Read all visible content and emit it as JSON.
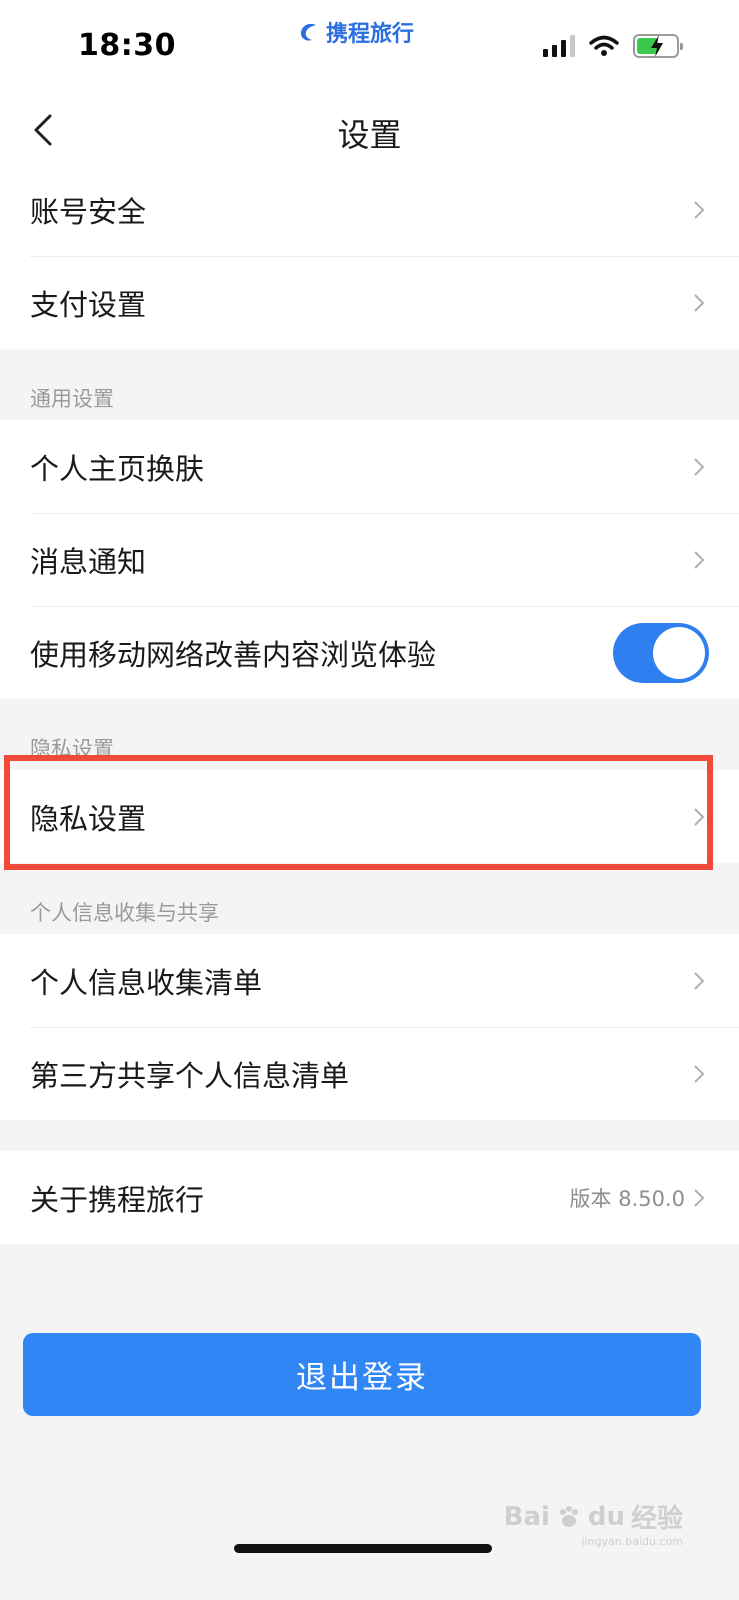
{
  "status_bar": {
    "time": "18:30",
    "brand": "携程旅行",
    "battery_color": "#3cc84a"
  },
  "nav": {
    "title": "设置"
  },
  "groups": {
    "account": [
      {
        "label": "账号安全"
      },
      {
        "label": "支付设置"
      }
    ],
    "general": {
      "header": "通用设置",
      "items": [
        {
          "label": "个人主页换肤"
        },
        {
          "label": "消息通知"
        },
        {
          "label": "使用移动网络改善内容浏览体验",
          "toggle_on": true
        }
      ]
    },
    "privacy": {
      "header": "隐私设置",
      "items": [
        {
          "label": "隐私设置"
        }
      ]
    },
    "personal_info": {
      "header": "个人信息收集与共享",
      "items": [
        {
          "label": "个人信息收集清单"
        },
        {
          "label": "第三方共享个人信息清单"
        }
      ]
    },
    "about": {
      "label": "关于携程旅行",
      "value": "版本 8.50.0"
    }
  },
  "logout": {
    "label": "退出登录"
  },
  "watermark": {
    "brand": "Bai",
    "brand2": "du",
    "sub_label": "经验",
    "url": "jingyan.baidu.com"
  },
  "colors": {
    "accent": "#2f86f4",
    "highlight": "#f14a3a",
    "toggle": "#2f7ff0"
  }
}
